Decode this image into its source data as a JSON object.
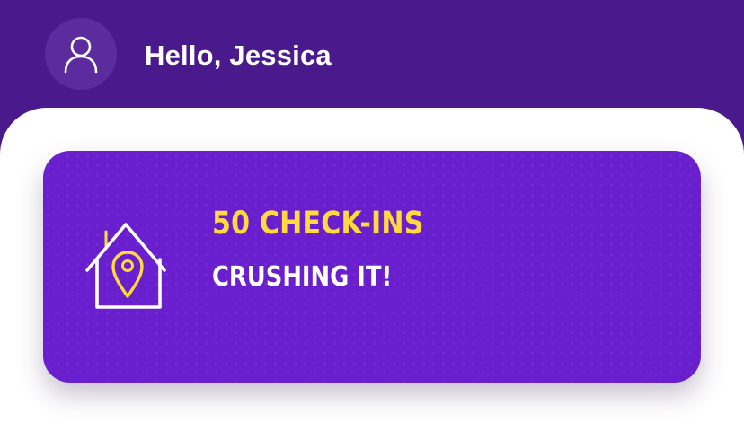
{
  "header": {
    "greeting": "Hello, Jessica",
    "avatar_icon": "user-icon"
  },
  "achievement": {
    "title": "50 CHECK-INS",
    "subtitle": "CRUSHING IT!",
    "icon": "house-location-pin-icon"
  },
  "colors": {
    "header_bg": "#4a1a8c",
    "avatar_bg": "#5c2c9e",
    "card_bg": "#6a1fcf",
    "title_accent": "#ffd93d",
    "text_white": "#ffffff"
  }
}
